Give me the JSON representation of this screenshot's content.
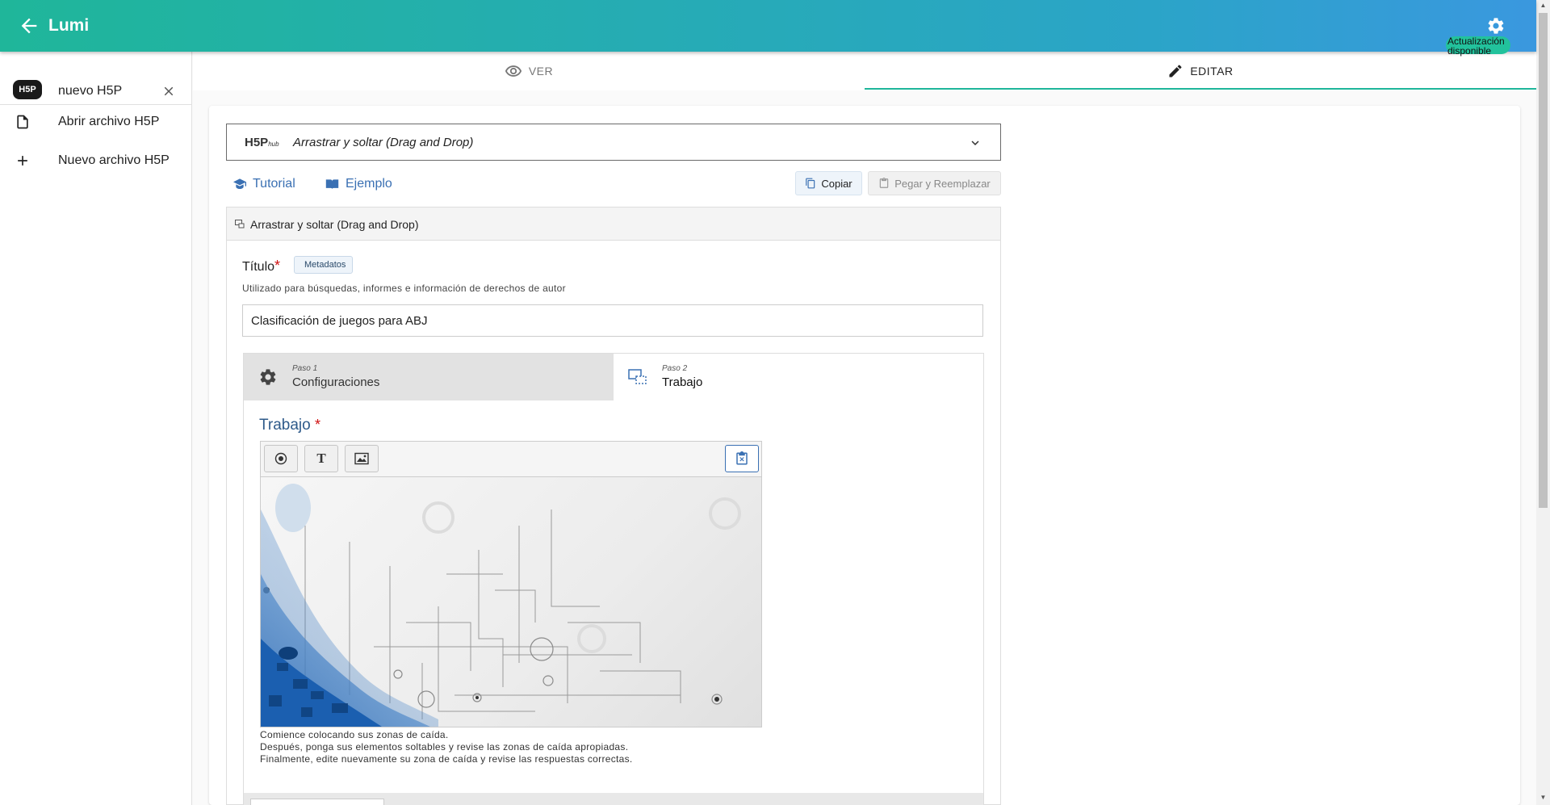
{
  "appbar": {
    "title": "Lumi",
    "update_badge": "Actualización disponible"
  },
  "sidebar": {
    "open_tab": {
      "logo": "H5P",
      "label": "nuevo H5P"
    },
    "items": [
      {
        "label": "Abrir archivo H5P",
        "icon": "file-icon"
      },
      {
        "label": "Nuevo archivo H5P",
        "icon": "plus-icon"
      }
    ]
  },
  "tabs": [
    {
      "label": "VER",
      "icon": "eye-icon",
      "active": false
    },
    {
      "label": "EDITAR",
      "icon": "pencil-icon",
      "active": true
    }
  ],
  "editor": {
    "hub": {
      "logo": "H5P",
      "logo_sub": "hub",
      "content_type": "Arrastrar y soltar (Drag and Drop)"
    },
    "links": {
      "tutorial": "Tutorial",
      "example": "Ejemplo"
    },
    "buttons": {
      "copy": "Copiar",
      "paste": "Pegar y Reemplazar"
    },
    "section_title": "Arrastrar y soltar (Drag and Drop)",
    "title_field": {
      "label": "Título",
      "required": "*",
      "metadata": "Metadatos",
      "description": "Utilizado para búsquedas, informes e información de derechos de autor",
      "value": "Clasificación de juegos para ABJ"
    },
    "steps": [
      {
        "step": "Paso 1",
        "name": "Configuraciones",
        "icon": "gear-icon"
      },
      {
        "step": "Paso 2",
        "name": "Trabajo",
        "icon": "task-icon"
      }
    ],
    "task": {
      "label": "Trabajo",
      "required": "*",
      "toolbar": {
        "text_tool": "T"
      },
      "instructions": [
        "Comience colocando sus zonas de caída.",
        "Después, ponga sus elementos soltables y revise las zonas de caída apropiadas.",
        "Finalmente, edite nuevamente su zona de caída y revise las respuestas correctas."
      ]
    }
  },
  "colors": {
    "appbar_start": "#1fb69a",
    "appbar_end": "#3a98df",
    "accent": "#1fb69a",
    "link": "#3a70b3",
    "required": "#d01010"
  }
}
